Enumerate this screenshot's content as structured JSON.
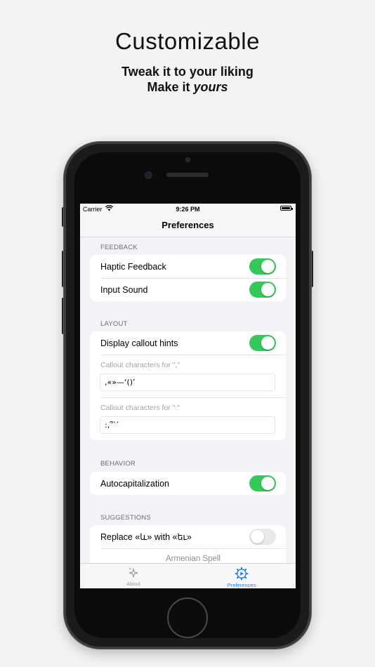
{
  "promo": {
    "headline": "Customizable",
    "line1": "Tweak it to your liking",
    "line2_prefix": "Make it ",
    "line2_emphasis": "yours"
  },
  "statusbar": {
    "carrier": "Carrier",
    "time": "9:26 PM"
  },
  "nav": {
    "title": "Preferences"
  },
  "sections": {
    "feedback": {
      "header": "FEEDBACK",
      "haptic_label": "Haptic Feedback",
      "haptic_on": true,
      "sound_label": "Input Sound",
      "sound_on": true
    },
    "layout": {
      "header": "LAYOUT",
      "callout_hints_label": "Display callout hints",
      "callout_hints_on": true,
      "comma_label": "Callout characters for \",\"",
      "comma_value": ",«»—‘()’",
      "colon_label": "Callout characters for \":\"",
      "colon_value": ":,՞`՛"
    },
    "behavior": {
      "header": "BEHAVIOR",
      "autocap_label": "Autocapitalization",
      "autocap_on": true
    },
    "suggestions": {
      "header": "SUGGESTIONS",
      "replace_label": "Replace «և» with «եւ»",
      "replace_on": false,
      "spell_label": "Armenian Spell"
    }
  },
  "tabs": {
    "about": "About",
    "preferences": "Preferences",
    "active": "preferences"
  },
  "colors": {
    "toggle_on": "#34c759",
    "toggle_off": "#e9e9eb",
    "tab_active": "#1a7cf5"
  }
}
